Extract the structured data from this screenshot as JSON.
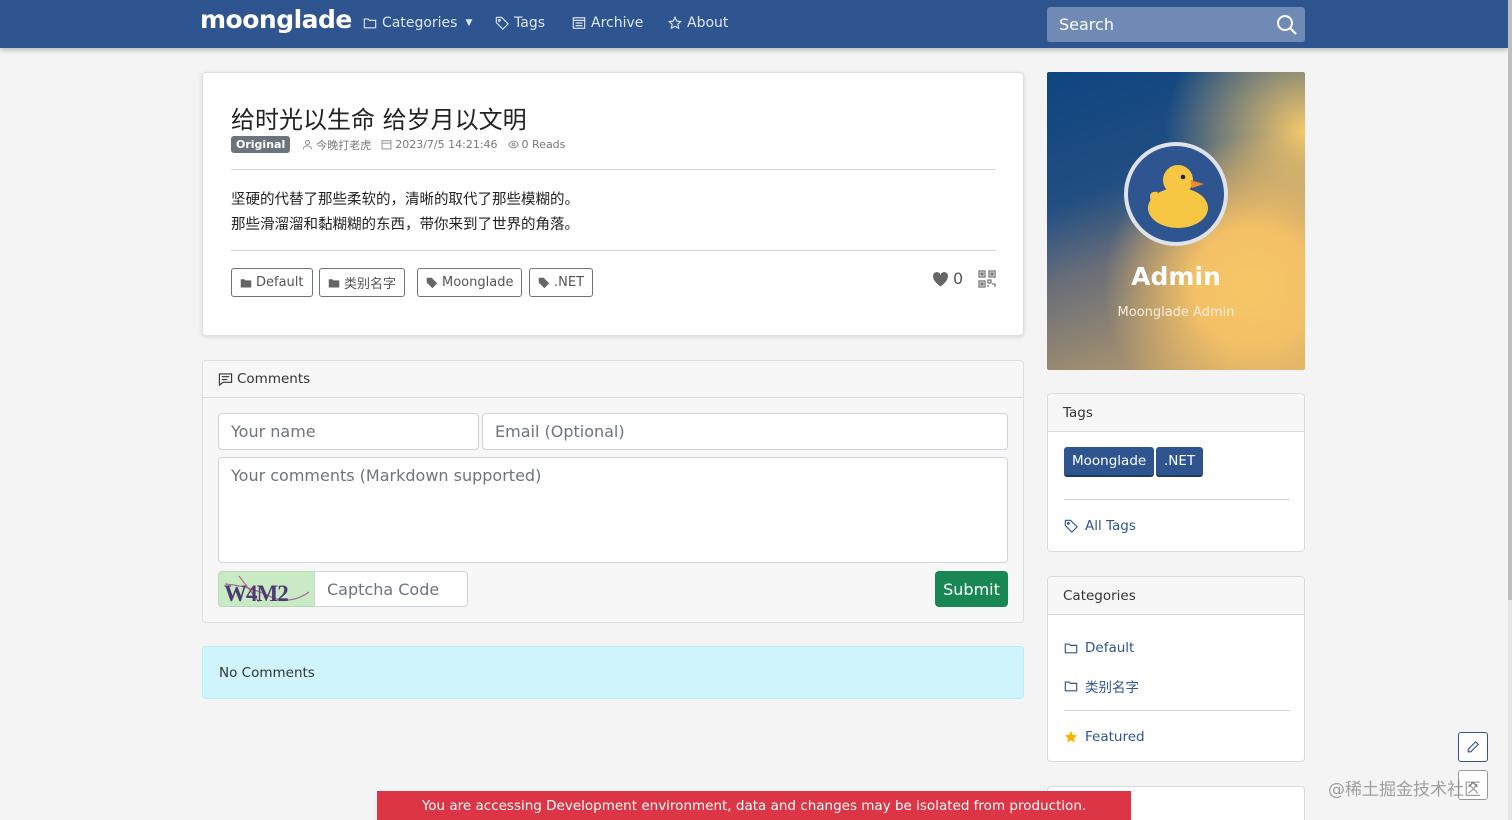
{
  "colors": {
    "nav_bg": "#2e5590",
    "primary": "#2e5590",
    "success": "#198754",
    "danger": "#dc3545",
    "info_bg": "#cff4fc",
    "badge_gray": "#6c757d"
  },
  "nav": {
    "brand": "moonglade",
    "items": [
      {
        "label": "Categories",
        "icon": "folder-icon",
        "has_caret": true
      },
      {
        "label": "Tags",
        "icon": "tag-icon"
      },
      {
        "label": "Archive",
        "icon": "archive-icon"
      },
      {
        "label": "About",
        "icon": "star-icon"
      }
    ],
    "search_placeholder": "Search"
  },
  "post": {
    "title": "给时光以生命 给岁月以文明",
    "badge": "Original",
    "author": "今晚打老虎",
    "date": "2023/7/5 14:21:46",
    "reads": "0 Reads",
    "body_lines": [
      "坚硬的代替了那些柔软的，清晰的取代了那些模糊的。",
      "那些滑溜溜和黏糊糊的东西，带你来到了世界的角落。"
    ],
    "tags": [
      "Default",
      "类别名字",
      "Moonglade",
      ".NET"
    ],
    "likes": "0"
  },
  "comments": {
    "header": "Comments",
    "name_placeholder": "Your name",
    "email_placeholder": "Email (Optional)",
    "comment_placeholder": "Your comments (Markdown supported)",
    "captcha_text": "W4M2",
    "captcha_placeholder": "Captcha Code",
    "submit_label": "Submit",
    "empty_message": "No Comments"
  },
  "profile": {
    "name": "Admin",
    "subtitle": "Moonglade Admin"
  },
  "sidebar": {
    "tags_header": "Tags",
    "tags": [
      "Moonglade",
      ".NET"
    ],
    "all_tags_label": "All Tags",
    "categories_header": "Categories",
    "categories": [
      "Default",
      "类别名字"
    ],
    "featured_label": "Featured"
  },
  "dev_banner": "You are accessing Development environment, data and changes may be isolated from production.",
  "watermark": "@稀土掘金技术社区"
}
